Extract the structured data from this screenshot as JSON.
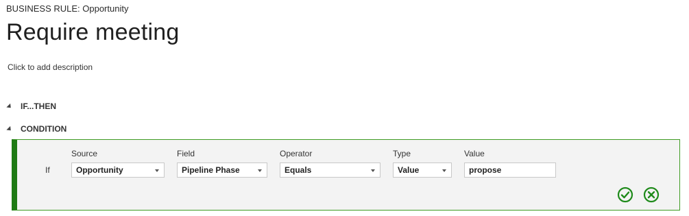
{
  "header": {
    "entity_line": "BUSINESS RULE: Opportunity",
    "title": "Require meeting",
    "description_placeholder": "Click to add description"
  },
  "sections": {
    "if_then": "IF...THEN",
    "condition": "CONDITION"
  },
  "condition": {
    "if_label": "If",
    "columns": {
      "source": "Source",
      "field": "Field",
      "operator": "Operator",
      "type": "Type",
      "value": "Value"
    },
    "values": {
      "source": "Opportunity",
      "field": "Pipeline Phase",
      "operator": "Equals",
      "type": "Value",
      "value": "propose"
    },
    "icons": {
      "accept": "check-circle-icon",
      "discard": "x-circle-icon"
    }
  },
  "colors": {
    "accent_green": "#1e7a14",
    "border_green": "#3f9b23",
    "panel_bg": "#f3f3f3"
  }
}
